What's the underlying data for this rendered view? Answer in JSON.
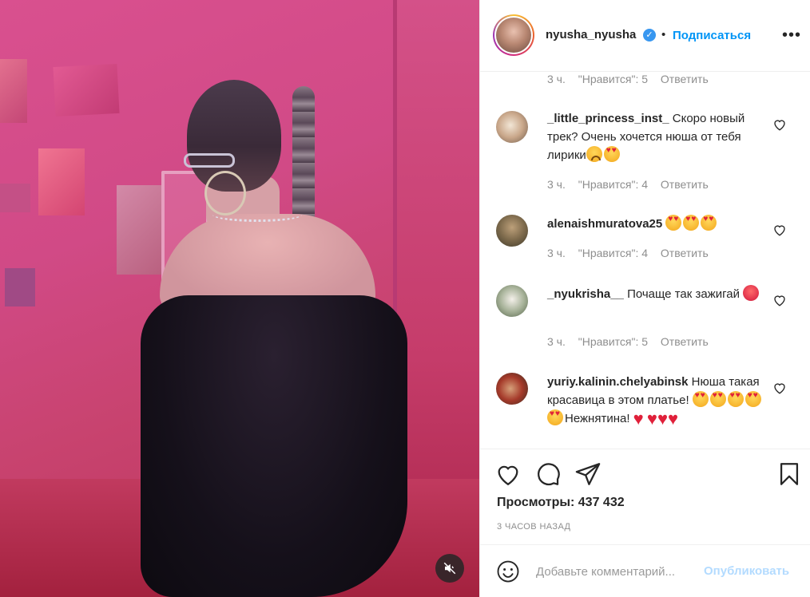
{
  "header": {
    "username": "nyusha_nyusha",
    "verified": "✓",
    "separator": "•",
    "follow_label": "Подписаться",
    "more_label": "•••"
  },
  "comments": {
    "top_meta": {
      "time": "3 ч.",
      "likes": "\"Нравится\": 5",
      "reply": "Ответить"
    },
    "items": [
      {
        "user": "_little_princess_inst_",
        "text": "Скоро новый трек? Очень хочется нюша от тебя лирики",
        "emojis": [
          "sad-face",
          "heart-eyes"
        ],
        "time": "3 ч.",
        "likes": "\"Нравится\": 4",
        "reply": "Ответить"
      },
      {
        "user": "alenaishmuratova25",
        "text": "",
        "emojis": [
          "heart-eyes",
          "heart-eyes",
          "heart-eyes"
        ],
        "time": "3 ч.",
        "likes": "\"Нравится\": 4",
        "reply": "Ответить"
      },
      {
        "user": "_nyukrisha__",
        "text": "Почаще так зажигай",
        "emojis": [
          "angry-face"
        ],
        "time": "3 ч.",
        "likes": "\"Нравится\": 5",
        "reply": "Ответить"
      },
      {
        "user": "yuriy.kalinin.chelyabinsk",
        "text": "Нюша такая красавица в этом платье!",
        "text2": "Нежнятина!",
        "emojis": [
          "heart-eyes",
          "heart-eyes",
          "heart-eyes",
          "heart-eyes",
          "heart-eyes",
          "red-heart",
          "red-heart",
          "red-heart",
          "red-heart"
        ]
      }
    ]
  },
  "post": {
    "views": "Просмотры: 437 432",
    "time_ago": "3 ЧАСОВ НАЗАД"
  },
  "compose": {
    "placeholder": "Добавьте комментарий...",
    "publish_label": "Опубликовать"
  },
  "icons": {
    "like": "heart-icon",
    "comment": "comment-icon",
    "share": "paper-plane-icon",
    "save": "bookmark-icon",
    "mute": "muted-speaker-icon",
    "emoji": "smile-icon"
  },
  "colors": {
    "accent": "#0095f6",
    "verified": "#3897f0",
    "publish_disabled": "#b3dbff"
  }
}
